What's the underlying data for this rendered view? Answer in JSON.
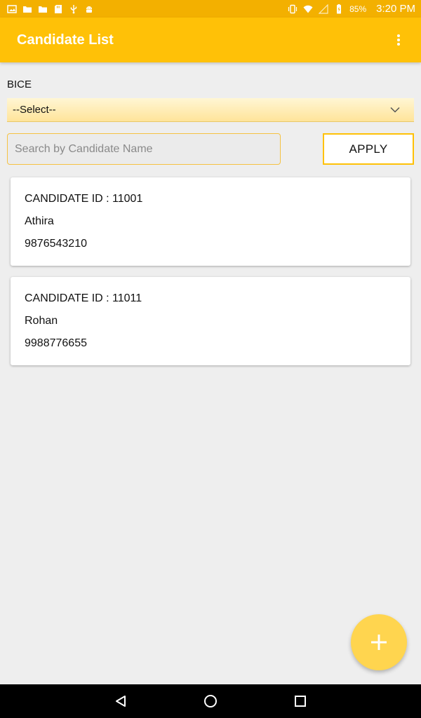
{
  "status_bar": {
    "battery_percent": "85%",
    "time": "3:20 PM"
  },
  "app_bar": {
    "title": "Candidate List"
  },
  "filter": {
    "label": "BICE",
    "selected_value": "--Select--"
  },
  "search": {
    "placeholder": "Search by Candidate Name",
    "value": ""
  },
  "apply_label": "APPLY",
  "candidates": [
    {
      "id_line": "CANDIDATE ID : 11001",
      "name": "Athira",
      "phone": "9876543210"
    },
    {
      "id_line": "CANDIDATE ID : 11011",
      "name": "Rohan",
      "phone": "9988776655"
    }
  ],
  "colors": {
    "status_bar": "#f3b000",
    "app_bar": "#ffc107",
    "fab": "#ffd54f",
    "background": "#eeeeee"
  },
  "icons": {
    "overflow": "more-vert-icon",
    "dropdown": "chevron-down-icon",
    "fab": "plus-icon",
    "nav": [
      "back-icon",
      "home-icon",
      "recents-icon"
    ]
  }
}
